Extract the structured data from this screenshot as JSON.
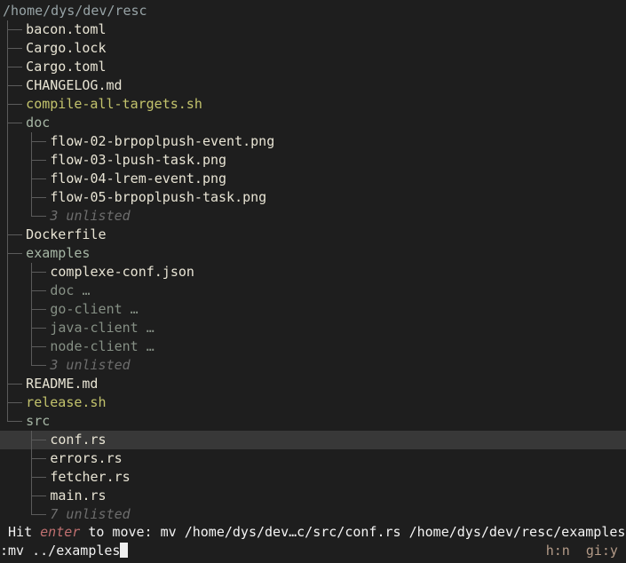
{
  "root_path": "/home/dys/dev/resc",
  "tree": [
    {
      "depth": 1,
      "name": "bacon.toml",
      "kind": "file",
      "last": false,
      "pass": []
    },
    {
      "depth": 1,
      "name": "Cargo.lock",
      "kind": "file",
      "last": false,
      "pass": []
    },
    {
      "depth": 1,
      "name": "Cargo.toml",
      "kind": "file",
      "last": false,
      "pass": []
    },
    {
      "depth": 1,
      "name": "CHANGELOG.md",
      "kind": "file",
      "last": false,
      "pass": []
    },
    {
      "depth": 1,
      "name": "compile-all-targets.sh",
      "kind": "exe",
      "last": false,
      "pass": []
    },
    {
      "depth": 1,
      "name": "doc",
      "kind": "dir",
      "last": false,
      "pass": []
    },
    {
      "depth": 2,
      "name": "flow-02-brpoplpush-event.png",
      "kind": "file",
      "last": false,
      "pass": [
        1
      ]
    },
    {
      "depth": 2,
      "name": "flow-03-lpush-task.png",
      "kind": "file",
      "last": false,
      "pass": [
        1
      ]
    },
    {
      "depth": 2,
      "name": "flow-04-lrem-event.png",
      "kind": "file",
      "last": false,
      "pass": [
        1
      ]
    },
    {
      "depth": 2,
      "name": "flow-05-brpoplpush-task.png",
      "kind": "file",
      "last": false,
      "pass": [
        1
      ]
    },
    {
      "depth": 2,
      "name": "3 unlisted",
      "kind": "unlisted",
      "last": true,
      "pass": [
        1
      ]
    },
    {
      "depth": 1,
      "name": "Dockerfile",
      "kind": "file",
      "last": false,
      "pass": []
    },
    {
      "depth": 1,
      "name": "examples",
      "kind": "dir",
      "last": false,
      "pass": []
    },
    {
      "depth": 2,
      "name": "complexe-conf.json",
      "kind": "file",
      "last": false,
      "pass": [
        1
      ]
    },
    {
      "depth": 2,
      "name": "doc …",
      "kind": "collapsed",
      "last": false,
      "pass": [
        1
      ]
    },
    {
      "depth": 2,
      "name": "go-client …",
      "kind": "collapsed",
      "last": false,
      "pass": [
        1
      ]
    },
    {
      "depth": 2,
      "name": "java-client …",
      "kind": "collapsed",
      "last": false,
      "pass": [
        1
      ]
    },
    {
      "depth": 2,
      "name": "node-client …",
      "kind": "collapsed",
      "last": false,
      "pass": [
        1
      ]
    },
    {
      "depth": 2,
      "name": "3 unlisted",
      "kind": "unlisted",
      "last": true,
      "pass": [
        1
      ]
    },
    {
      "depth": 1,
      "name": "README.md",
      "kind": "file",
      "last": false,
      "pass": []
    },
    {
      "depth": 1,
      "name": "release.sh",
      "kind": "exe",
      "last": false,
      "pass": []
    },
    {
      "depth": 1,
      "name": "src",
      "kind": "dir",
      "last": true,
      "pass": []
    },
    {
      "depth": 2,
      "name": "conf.rs",
      "kind": "file",
      "last": false,
      "pass": [],
      "selected": true
    },
    {
      "depth": 2,
      "name": "errors.rs",
      "kind": "file",
      "last": false,
      "pass": []
    },
    {
      "depth": 2,
      "name": "fetcher.rs",
      "kind": "file",
      "last": false,
      "pass": []
    },
    {
      "depth": 2,
      "name": "main.rs",
      "kind": "file",
      "last": false,
      "pass": []
    },
    {
      "depth": 2,
      "name": "7 unlisted",
      "kind": "unlisted",
      "last": true,
      "pass": []
    }
  ],
  "status": {
    "hit": " Hit ",
    "key": "enter",
    "to_move": " to move: ",
    "command": "mv /home/dys/dev…c/src/conf.rs /home/dys/dev/resc/examples"
  },
  "input": {
    "text": ":mv ../examples"
  },
  "flags": [
    {
      "label": "h:n"
    },
    {
      "label": "gi:y"
    }
  ],
  "colors": {
    "background": "#1e1e1e",
    "selected_row": "#383838",
    "directory": "#a6b6a5",
    "executable": "#c3c36c",
    "key_hint": "#c07070"
  }
}
